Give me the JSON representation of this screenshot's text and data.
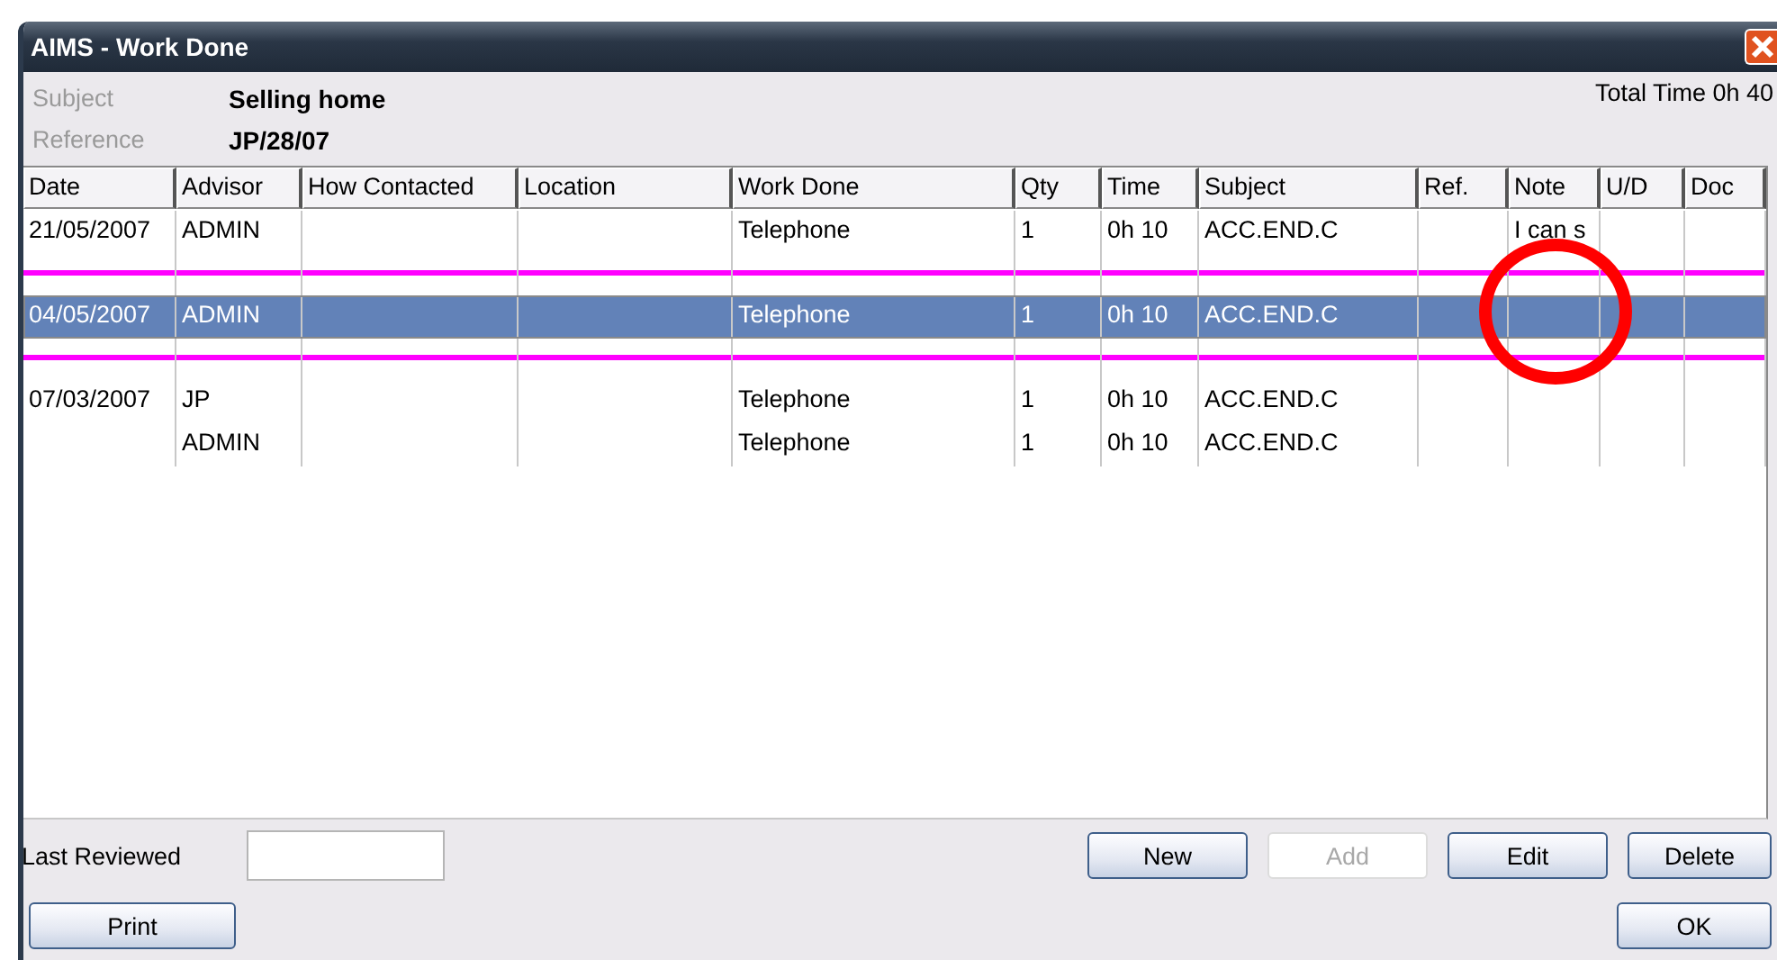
{
  "window": {
    "title": "AIMS - Work Done"
  },
  "header": {
    "fields": [
      {
        "label": "Subject",
        "value": "Selling home"
      },
      {
        "label": "Reference",
        "value": "JP/28/07"
      }
    ],
    "total_time": "Total Time 0h 40"
  },
  "table": {
    "columns": [
      "Date",
      "Advisor",
      "How Contacted",
      "Location",
      "Work Done",
      "Qty",
      "Time",
      "Subject",
      "Ref.",
      "Note",
      "U/D",
      "Doc"
    ],
    "rows": [
      {
        "kind": "entry",
        "selected": false,
        "cells": [
          "21/05/2007",
          "ADMIN",
          "",
          "",
          "Telephone",
          "1",
          "0h 10",
          "ACC.END.C",
          "",
          "I can s",
          "",
          ""
        ]
      },
      {
        "kind": "divider"
      },
      {
        "kind": "entry",
        "selected": true,
        "cells": [
          "04/05/2007",
          "ADMIN",
          "",
          "",
          "Telephone",
          "1",
          "0h 10",
          "ACC.END.C",
          "",
          "",
          "",
          ""
        ]
      },
      {
        "kind": "divider"
      },
      {
        "kind": "entry",
        "selected": false,
        "cells": [
          "07/03/2007",
          "JP",
          "",
          "",
          "Telephone",
          "1",
          "0h 10",
          "ACC.END.C",
          "",
          "",
          "",
          ""
        ]
      },
      {
        "kind": "entry",
        "selected": false,
        "cells": [
          "",
          "ADMIN",
          "",
          "",
          "Telephone",
          "1",
          "0h 10",
          "ACC.END.C",
          "",
          "",
          "",
          ""
        ]
      }
    ]
  },
  "last_reviewed": {
    "label": "Last Reviewed"
  },
  "buttons": [
    {
      "label": "New",
      "disabled": false
    },
    {
      "label": "Add",
      "disabled": true
    },
    {
      "label": "Edit",
      "disabled": false
    },
    {
      "label": "Delete",
      "disabled": false
    }
  ],
  "footer_buttons": [
    {
      "label": "Print",
      "disabled": false
    },
    {
      "label": "OK",
      "disabled": false
    }
  ]
}
